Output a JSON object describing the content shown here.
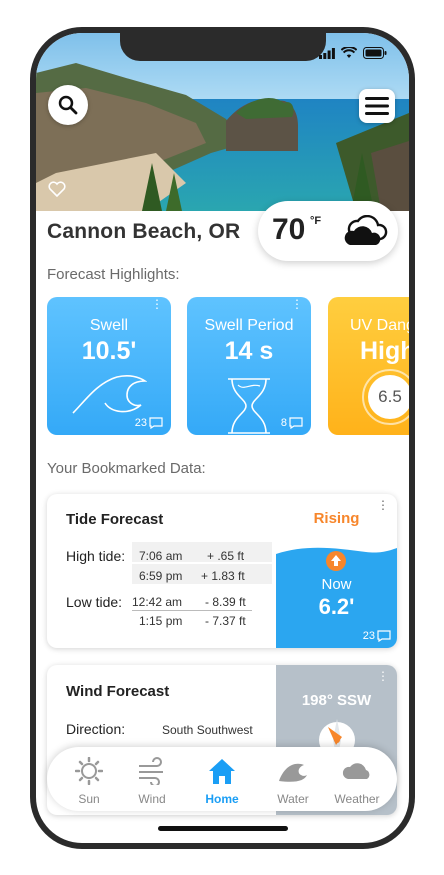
{
  "location": "Cannon Beach, OR",
  "current": {
    "temp": "70",
    "unit": "°F",
    "condition_icon": "cloudy-icon"
  },
  "sections": {
    "highlights": "Forecast Highlights:",
    "bookmarked": "Your Bookmarked Data:"
  },
  "highlights": [
    {
      "label": "Swell",
      "value": "10.5'",
      "count": "23",
      "icon": "wave-icon",
      "color": "#34a9f7"
    },
    {
      "label": "Swell Period",
      "value": "14 s",
      "count": "8",
      "icon": "hourglass-icon",
      "color": "#34a9f7"
    },
    {
      "label": "UV Dang",
      "value": "High",
      "gauge": "6.5",
      "icon": "uv-gauge",
      "color": "#ffb21a"
    }
  ],
  "tide": {
    "title": "Tide Forecast",
    "high_label": "High tide:",
    "low_label": "Low tide:",
    "high": [
      {
        "time": "7:06 am",
        "change": "+ .65 ft"
      },
      {
        "time": "6:59 pm",
        "change": "+ 1.83 ft"
      }
    ],
    "low": [
      {
        "time": "12:42 am",
        "change": "- 8.39 ft"
      },
      {
        "time": "1:15 pm",
        "change": "- 7.37 ft"
      }
    ],
    "trend": "Rising",
    "now_label": "Now",
    "now_value": "6.2'",
    "count": "23"
  },
  "wind": {
    "title": "Wind Forecast",
    "direction_label": "Direction:",
    "direction_value": "South Southwest",
    "heading": "198° SSW"
  },
  "tabs": [
    {
      "label": "Sun",
      "icon": "sun-icon"
    },
    {
      "label": "Wind",
      "icon": "wind-icon"
    },
    {
      "label": "Home",
      "icon": "home-icon",
      "active": true
    },
    {
      "label": "Water",
      "icon": "wave-icon"
    },
    {
      "label": "Weather",
      "icon": "cloud-icon"
    }
  ]
}
